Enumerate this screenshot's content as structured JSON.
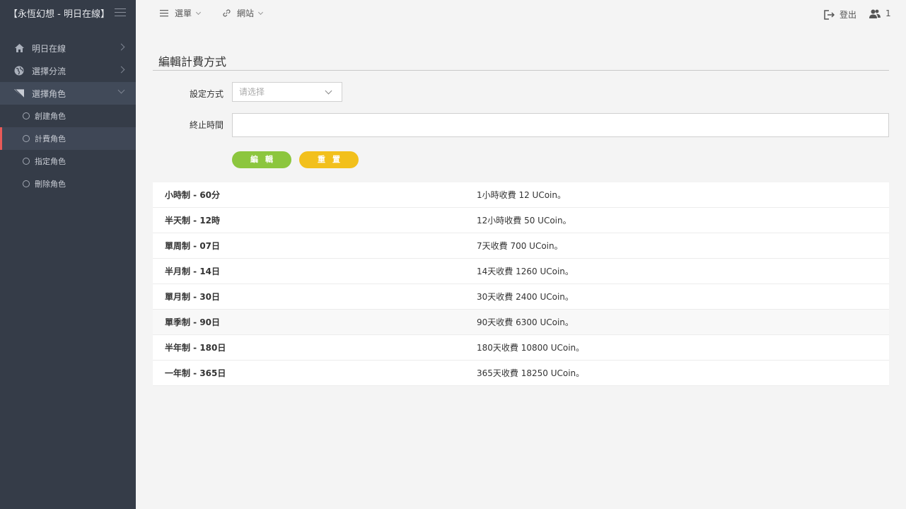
{
  "app": {
    "title": "【永恆幻想 - 明日在線】"
  },
  "sidebar": {
    "items": [
      {
        "label": "明日在線",
        "icon": "home-icon"
      },
      {
        "label": "選擇分流",
        "icon": "globe-icon"
      },
      {
        "label": "選擇角色",
        "icon": "send-icon"
      }
    ],
    "subitems": [
      {
        "label": "創建角色"
      },
      {
        "label": "計費角色"
      },
      {
        "label": "指定角色"
      },
      {
        "label": "刪除角色"
      }
    ],
    "active_subitem": "計費角色"
  },
  "topbar": {
    "menu_label": "選單",
    "site_label": "網站",
    "logout_label": "登出",
    "user_count": "1"
  },
  "page": {
    "title": "編輯計費方式",
    "setting_label": "設定方式",
    "setting_placeholder": "请选择",
    "end_time_label": "終止時間",
    "end_time_value": "",
    "edit_button": "編輯",
    "reset_button": "重置"
  },
  "table": {
    "rows": [
      {
        "plan": "小時制 - 60分",
        "desc": "1小時收費 12 UCoin。"
      },
      {
        "plan": "半天制 - 12時",
        "desc": "12小時收費 50 UCoin。"
      },
      {
        "plan": "單周制 - 07日",
        "desc": "7天收費 700 UCoin。"
      },
      {
        "plan": "半月制 - 14日",
        "desc": "14天收費 1260 UCoin。"
      },
      {
        "plan": "單月制 - 30日",
        "desc": "30天收費 2400 UCoin。"
      },
      {
        "plan": "單季制 - 90日",
        "desc": "90天收費 6300 UCoin。"
      },
      {
        "plan": "半年制 - 180日",
        "desc": "180天收費 10800 UCoin。"
      },
      {
        "plan": "一年制 - 365日",
        "desc": "365天收費 18250 UCoin。"
      }
    ]
  },
  "colors": {
    "sidebar_bg": "#353c48",
    "active_marker": "#e85a58",
    "edit_button": "#8cc63e",
    "reset_button": "#f2c01c"
  }
}
